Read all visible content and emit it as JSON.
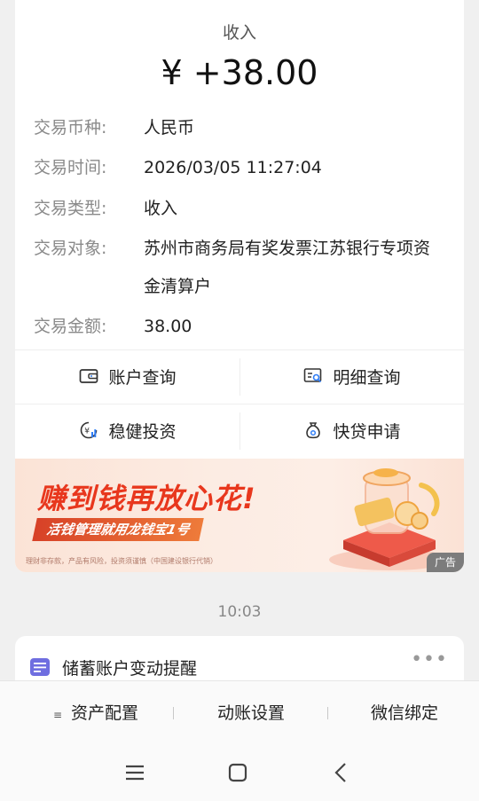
{
  "transaction": {
    "type_title": "收入",
    "amount": "¥ +38.00",
    "rows": [
      {
        "label": "交易币种:",
        "value": "人民币"
      },
      {
        "label": "交易时间:",
        "value": "2026/03/05 11:27:04"
      },
      {
        "label": "交易类型:",
        "value": "收入"
      },
      {
        "label": "交易对象:",
        "value": "苏州市商务局有奖发票江苏银行专项资",
        "value_line2": "金清算户"
      },
      {
        "label": "交易金额:",
        "value": "38.00"
      }
    ]
  },
  "actions": [
    {
      "label": "账户查询",
      "icon": "wallet-icon"
    },
    {
      "label": "明细查询",
      "icon": "statement-search-icon"
    },
    {
      "label": "稳健投资",
      "icon": "investment-chart-icon"
    },
    {
      "label": "快贷申请",
      "icon": "money-bag-icon"
    }
  ],
  "banner": {
    "title": "赚到钱再放心花!",
    "subtitle": "活钱管理就用龙钱宝1号",
    "disclaimer": "理财非存款，产品有风险，投资须谨慎（中国建设银行代销）",
    "ad_tag": "广告",
    "accent_color": "#e8371d"
  },
  "chat": {
    "time_separator": "10:03",
    "message_title": "储蓄账户变动提醒",
    "more_icon": "more-dots-icon"
  },
  "bottom_menu": {
    "items": [
      {
        "label": "资产配置",
        "icon": "menu-lines-icon"
      },
      {
        "label": "动账设置"
      },
      {
        "label": "微信绑定"
      }
    ]
  },
  "system_nav": {
    "menu_icon": "recent-apps-icon",
    "home_icon": "home-icon",
    "back_icon": "back-icon"
  }
}
